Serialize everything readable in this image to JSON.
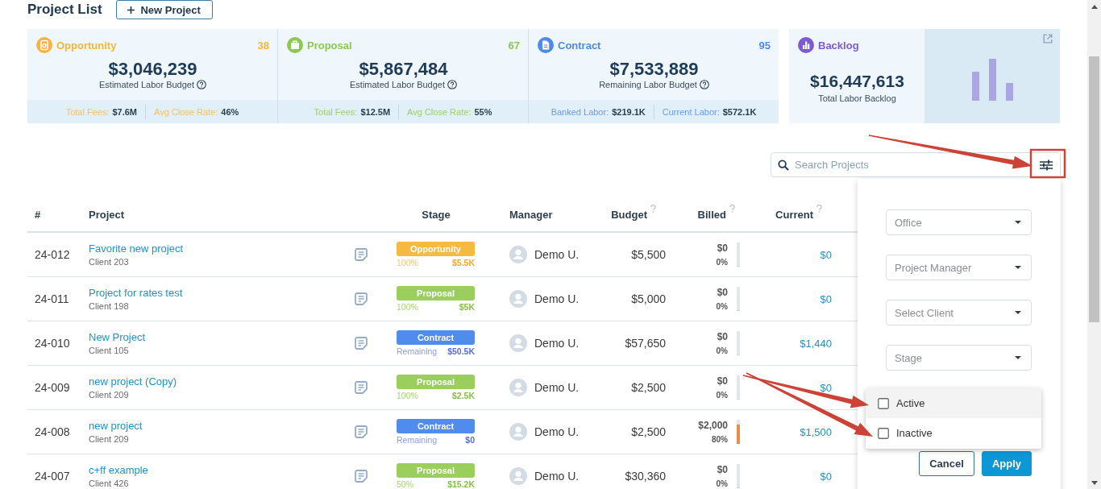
{
  "header": {
    "title": "Project List",
    "new_button": "New Project"
  },
  "summary_cards": [
    {
      "kind": "opportunity",
      "title": "Opportunity",
      "count": "38",
      "amount": "$3,046,239",
      "caption": "Estimated Labor Budget",
      "stats": [
        {
          "label": "Total Fees:",
          "value": "$7.6M"
        },
        {
          "label": "Avg Close Rate:",
          "value": "46%"
        }
      ]
    },
    {
      "kind": "proposal",
      "title": "Proposal",
      "count": "67",
      "amount": "$5,867,484",
      "caption": "Estimated Labor Budget",
      "stats": [
        {
          "label": "Total Fees:",
          "value": "$12.5M"
        },
        {
          "label": "Avg Close Rate:",
          "value": "55%"
        }
      ]
    },
    {
      "kind": "contract",
      "title": "Contract",
      "count": "95",
      "amount": "$7,533,889",
      "caption": "Remaining Labor Budget",
      "stats": [
        {
          "label": "Banked Labor:",
          "value": "$219.1K"
        },
        {
          "label": "Current Labor:",
          "value": "$572.1K"
        }
      ]
    }
  ],
  "backlog_card": {
    "title": "Backlog",
    "amount": "$16,447,613",
    "caption": "Total Labor Backlog"
  },
  "search": {
    "placeholder": "Search Projects"
  },
  "table": {
    "columns": [
      {
        "label": "#",
        "help": false
      },
      {
        "label": "Project",
        "help": false
      },
      {
        "label": "Stage",
        "help": false
      },
      {
        "label": "Manager",
        "help": false
      },
      {
        "label": "Budget",
        "help": true
      },
      {
        "label": "Billed",
        "help": true
      },
      {
        "label": "Current",
        "help": true
      }
    ],
    "rows": [
      {
        "number": "24-012",
        "project": "Favorite new project",
        "client": "Client 203",
        "stage": {
          "kind": "opportunity",
          "label": "Opportunity",
          "caption": "100%",
          "amount": "$5.5K"
        },
        "manager": "Demo U.",
        "budget": "$5,500",
        "billed": {
          "amount": "$0",
          "percent": "0%",
          "level": 0
        },
        "current": "$0"
      },
      {
        "number": "24-011",
        "project": "Project for rates test",
        "client": "Client 198",
        "stage": {
          "kind": "proposal",
          "label": "Proposal",
          "caption": "100%",
          "amount": "$5K"
        },
        "manager": "Demo U.",
        "budget": "$5,000",
        "billed": {
          "amount": "$0",
          "percent": "0%",
          "level": 0
        },
        "current": "$0"
      },
      {
        "number": "24-010",
        "project": "New Project",
        "client": "Client 105",
        "stage": {
          "kind": "contract",
          "label": "Contract",
          "caption": "Remaining",
          "amount": "$50.5K"
        },
        "manager": "Demo U.",
        "budget": "$57,650",
        "billed": {
          "amount": "$0",
          "percent": "0%",
          "level": 0
        },
        "current": "$1,440"
      },
      {
        "number": "24-009",
        "project": "new project (Copy)",
        "client": "Client 209",
        "stage": {
          "kind": "proposal",
          "label": "Proposal",
          "caption": "100%",
          "amount": "$2.5K"
        },
        "manager": "Demo U.",
        "budget": "$2,500",
        "billed": {
          "amount": "$0",
          "percent": "0%",
          "level": 0
        },
        "current": "$0"
      },
      {
        "number": "24-008",
        "project": "new project",
        "client": "Client 209",
        "stage": {
          "kind": "contract",
          "label": "Contract",
          "caption": "Remaining",
          "amount": "$0"
        },
        "manager": "Demo U.",
        "budget": "$2,500",
        "billed": {
          "amount": "$2,000",
          "percent": "80%",
          "level": 0.8
        },
        "current": "$1,500"
      },
      {
        "number": "24-007",
        "project": "c+ff example",
        "client": "Client 426",
        "stage": {
          "kind": "proposal",
          "label": "Proposal",
          "caption": "50%",
          "amount": "$15.2K"
        },
        "manager": "Demo U.",
        "budget": "$30,360",
        "billed": {
          "amount": "$0",
          "percent": "0%",
          "level": 0
        },
        "current": "$0"
      }
    ]
  },
  "filter_panel": {
    "selects": [
      {
        "label": "Office"
      },
      {
        "label": "Project Manager"
      },
      {
        "label": "Select Client"
      },
      {
        "label": "Stage"
      }
    ],
    "status_options": [
      {
        "label": "Active",
        "checked": false,
        "hovered": true
      },
      {
        "label": "Inactive",
        "checked": false,
        "hovered": false
      }
    ],
    "buttons": [
      {
        "label": "Cancel",
        "kind": "secondary"
      },
      {
        "label": "Apply",
        "kind": "primary"
      }
    ]
  }
}
